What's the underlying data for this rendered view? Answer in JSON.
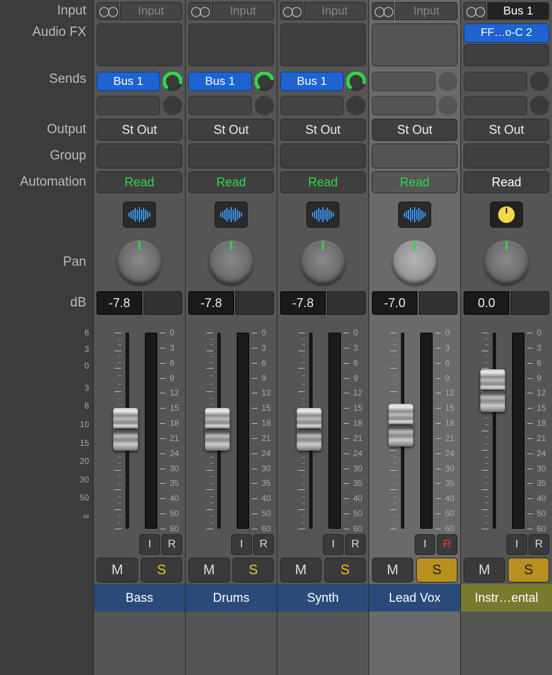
{
  "labels": {
    "input": "Input",
    "audio_fx": "Audio FX",
    "sends": "Sends",
    "output": "Output",
    "group": "Group",
    "automation": "Automation",
    "pan": "Pan",
    "db": "dB"
  },
  "ir": {
    "i": "I",
    "r": "R"
  },
  "ms": {
    "m": "M",
    "s": "S"
  },
  "scale_left": [
    "6",
    "3",
    "0",
    "3",
    "6",
    "10",
    "15",
    "20",
    "30",
    "50",
    "∞"
  ],
  "scale_right": [
    "0",
    "3",
    "6",
    "9",
    "12",
    "15",
    "18",
    "21",
    "24",
    "30",
    "35",
    "40",
    "50",
    "60"
  ],
  "tracks": [
    {
      "name": "Bass",
      "name_color": "blue",
      "selected": false,
      "input": {
        "stereo": true,
        "label": "Input",
        "active": false
      },
      "fx": [],
      "sends": [
        {
          "label": "Bus 1",
          "level": 0.85
        }
      ],
      "output": "St Out",
      "automation": {
        "label": "Read",
        "style": "green"
      },
      "mode": "wave",
      "pan_bright": false,
      "db": "-7.8",
      "fader_pos": 0.5,
      "rec_armed": false,
      "solo_active": false
    },
    {
      "name": "Drums",
      "name_color": "blue",
      "selected": false,
      "input": {
        "stereo": true,
        "label": "Input",
        "active": false
      },
      "fx": [],
      "sends": [
        {
          "label": "Bus 1",
          "level": 0.75
        }
      ],
      "output": "St Out",
      "automation": {
        "label": "Read",
        "style": "green"
      },
      "mode": "wave",
      "pan_bright": false,
      "db": "-7.8",
      "fader_pos": 0.5,
      "rec_armed": false,
      "solo_active": false
    },
    {
      "name": "Synth",
      "name_color": "blue",
      "selected": false,
      "input": {
        "stereo": true,
        "label": "Input",
        "active": false
      },
      "fx": [],
      "sends": [
        {
          "label": "Bus 1",
          "level": 0.85
        }
      ],
      "output": "St Out",
      "automation": {
        "label": "Read",
        "style": "green"
      },
      "mode": "wave",
      "pan_bright": false,
      "db": "-7.8",
      "fader_pos": 0.5,
      "rec_armed": false,
      "solo_active": false
    },
    {
      "name": "Lead Vox",
      "name_color": "blue",
      "selected": true,
      "input": {
        "stereo": true,
        "label": "Input",
        "active": false
      },
      "fx": [],
      "sends": [],
      "output": "St Out",
      "automation": {
        "label": "Read",
        "style": "green"
      },
      "mode": "wave",
      "pan_bright": true,
      "db": "-7.0",
      "fader_pos": 0.48,
      "rec_armed": true,
      "solo_active": true
    },
    {
      "name": "Instr…ental",
      "name_color": "olive",
      "selected": false,
      "input": {
        "stereo": true,
        "label": "Bus 1",
        "active": true
      },
      "fx": [
        "FF…o-C 2"
      ],
      "sends": [],
      "output": "St Out",
      "automation": {
        "label": "Read",
        "style": "white"
      },
      "mode": "pan",
      "pan_bright": false,
      "db": "0.0",
      "fader_pos": 0.3,
      "rec_armed": false,
      "solo_active": true
    }
  ]
}
